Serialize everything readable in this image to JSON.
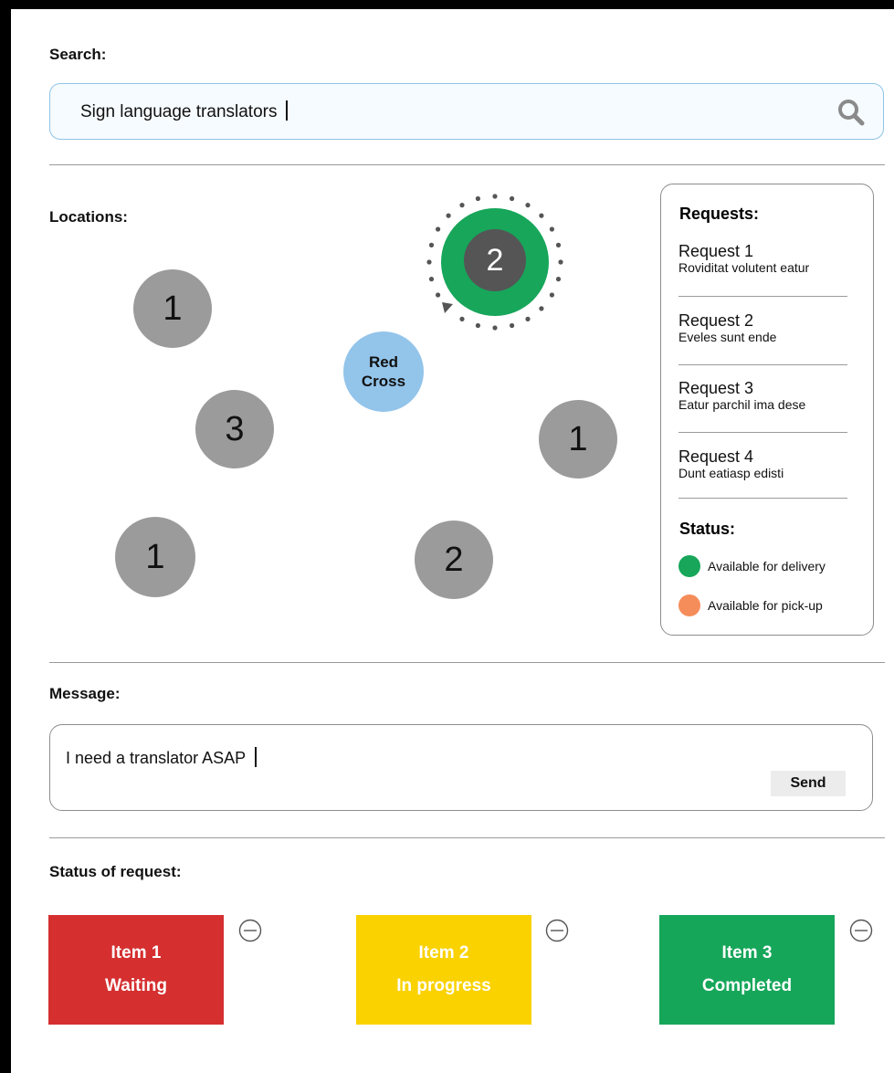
{
  "search": {
    "label": "Search:",
    "value": "Sign language translators"
  },
  "locations": {
    "label": "Locations:",
    "pins": [
      {
        "id": "pin-a",
        "count": "1"
      },
      {
        "id": "pin-b",
        "count": "3"
      },
      {
        "id": "pin-c",
        "count": "1"
      },
      {
        "id": "pin-d",
        "count": "2"
      },
      {
        "id": "pin-e",
        "count": "1"
      }
    ],
    "selected_pin": {
      "count": "2"
    },
    "highlight": {
      "label_line1": "Red",
      "label_line2": "Cross"
    }
  },
  "requests": {
    "title": "Requests:",
    "items": [
      {
        "title": "Request 1",
        "subtitle": "Roviditat volutent eatur"
      },
      {
        "title": "Request 2",
        "subtitle": "Eveles sunt ende"
      },
      {
        "title": "Request 3",
        "subtitle": "Eatur parchil ima dese"
      },
      {
        "title": "Request 4",
        "subtitle": "Dunt eatiasp edisti"
      }
    ],
    "status_title": "Status:",
    "legend": [
      {
        "label": "Available for delivery",
        "color": "#17a65a"
      },
      {
        "label": "Available for pick-up",
        "color": "#f58d5a"
      }
    ]
  },
  "message": {
    "label": "Message:",
    "value": "I need a translator ASAP",
    "send_label": "Send"
  },
  "status_of_request": {
    "label": "Status of request:",
    "cards": [
      {
        "item": "Item 1",
        "state": "Waiting",
        "color": "#d52f30"
      },
      {
        "item": "Item 2",
        "state": "In progress",
        "color": "#fad200"
      },
      {
        "item": "Item 3",
        "state": "Completed",
        "color": "#16a65a"
      }
    ]
  },
  "colors": {
    "accent_border": "#8ec3e6",
    "pin_gray": "#9b9b9c",
    "selected_green": "#17a65a"
  }
}
